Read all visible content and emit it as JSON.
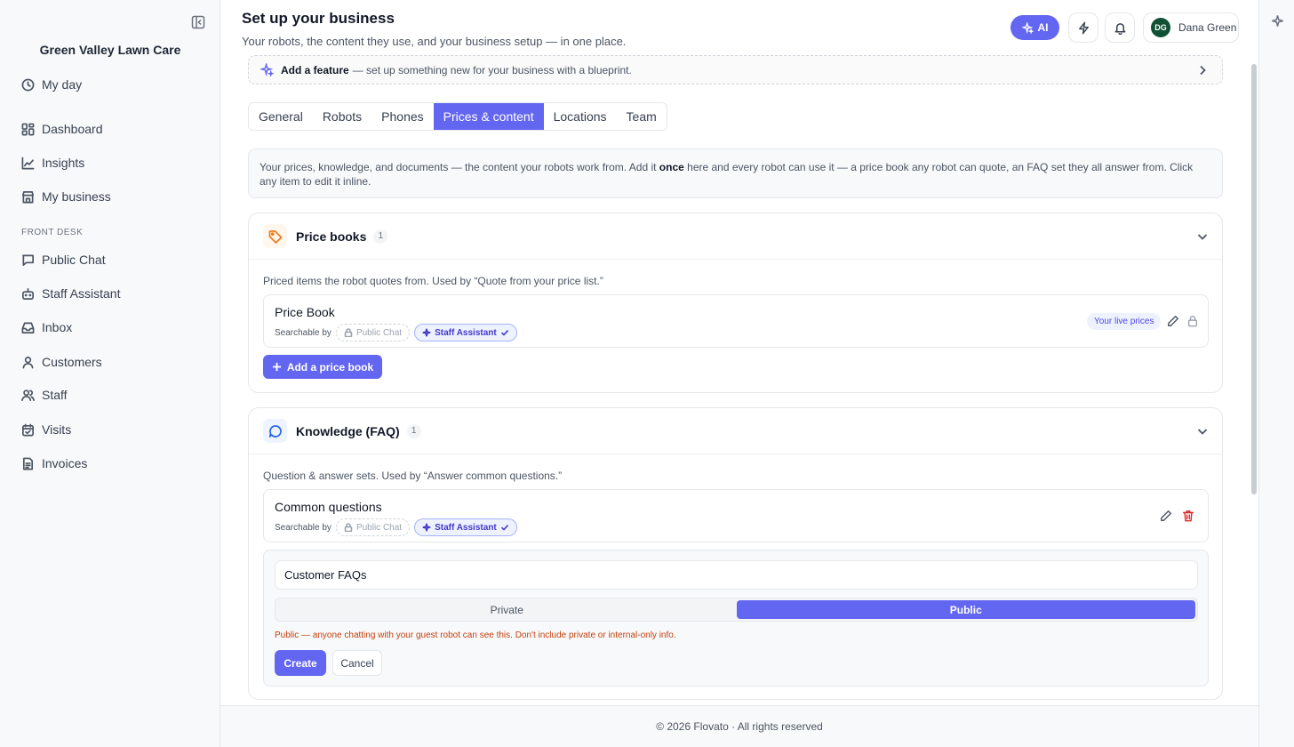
{
  "sidebar": {
    "business_name": "Green Valley Lawn Care",
    "my_day": "My day",
    "items": [
      {
        "label": "Dashboard",
        "icon": "dashboard-icon"
      },
      {
        "label": "Insights",
        "icon": "chart-icon"
      },
      {
        "label": "My business",
        "icon": "store-icon"
      }
    ],
    "section_label": "FRONT DESK",
    "front_desk": [
      {
        "label": "Public Chat",
        "icon": "chat-icon"
      },
      {
        "label": "Staff Assistant",
        "icon": "robot-icon"
      },
      {
        "label": "Inbox",
        "icon": "inbox-icon"
      },
      {
        "label": "Customers",
        "icon": "user-icon"
      },
      {
        "label": "Staff",
        "icon": "users-icon"
      },
      {
        "label": "Visits",
        "icon": "calendar-icon"
      },
      {
        "label": "Invoices",
        "icon": "document-icon"
      }
    ]
  },
  "header": {
    "title": "Set up your business",
    "subtitle": "Your robots, the content they use, and your business setup — in one place.",
    "ai_label": "AI",
    "user_initials": "DG",
    "user_name": "Dana Green"
  },
  "feature_banner": {
    "bold": "Add a feature",
    "text": "— set up something new for your business with a blueprint."
  },
  "tabs": [
    "General",
    "Robots",
    "Phones",
    "Prices & content",
    "Locations",
    "Team"
  ],
  "active_tab": "Prices & content",
  "info": {
    "before": "Your prices, knowledge, and documents — the content your robots work from. Add it ",
    "bold": "once",
    "after": " here and every robot can use it — a price book any robot can quote, an FAQ set they all answer from. Click any item to edit it inline."
  },
  "price_books": {
    "title": "Price books",
    "count": "1",
    "description": "Priced items the robot quotes from. Used by “Quote from your price list.”",
    "item_name": "Price Book",
    "searchable_by": "Searchable by",
    "chip_public": "Public Chat",
    "chip_staff": "Staff Assistant",
    "badge": "Your live prices",
    "add_label": "Add a price book"
  },
  "knowledge": {
    "title": "Knowledge (FAQ)",
    "count": "1",
    "description": "Question & answer sets. Used by “Answer common questions.”",
    "item_name": "Common questions",
    "searchable_by": "Searchable by",
    "chip_public": "Public Chat",
    "chip_staff": "Staff Assistant",
    "form": {
      "name_value": "Customer FAQs",
      "private_label": "Private",
      "public_label": "Public",
      "selected": "Public",
      "warning": "Public — anyone chatting with your guest robot can see this. Don't include private or internal-only info.",
      "create_label": "Create",
      "cancel_label": "Cancel"
    }
  },
  "footer": "© 2026 Flovato · All rights reserved",
  "colors": {
    "accent": "#6366f1",
    "warning": "#c2410c",
    "avatar": "#0f5132"
  }
}
